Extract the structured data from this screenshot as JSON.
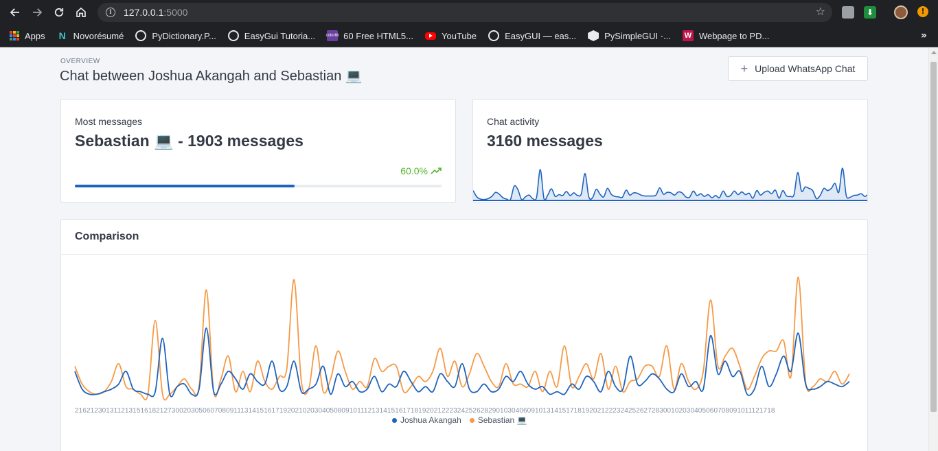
{
  "browser": {
    "url_host": "127.0.0.1",
    "url_port": ":5000",
    "bookmarks": [
      {
        "label": "Apps",
        "icon": "apps-icon"
      },
      {
        "label": "Novorésumé",
        "icon": "novoresume-icon"
      },
      {
        "label": "PyDictionary.P...",
        "icon": "globe-icon"
      },
      {
        "label": "EasyGui Tutoria...",
        "icon": "globe-icon"
      },
      {
        "label": "60 Free HTML5...",
        "icon": "colorlib-icon"
      },
      {
        "label": "YouTube",
        "icon": "youtube-icon"
      },
      {
        "label": "EasyGUI — eas...",
        "icon": "globe-icon"
      },
      {
        "label": "PySimpleGUI ·...",
        "icon": "pysimplegui-icon"
      },
      {
        "label": "Webpage to PD...",
        "icon": "webpage-to-pdf-icon"
      }
    ],
    "more": "»"
  },
  "header": {
    "overline": "OVERVIEW",
    "title": "Chat between Joshua Akangah and Sebastian 💻",
    "upload_label": "Upload WhatsApp Chat"
  },
  "most_messages": {
    "label": "Most messages",
    "value": "Sebastian 💻 - 1903 messages",
    "percent": "60.0%",
    "progress": 0.6
  },
  "chat_activity": {
    "label": "Chat activity",
    "value": "3160 messages"
  },
  "comparison": {
    "title": "Comparison",
    "colors": {
      "joshua": "#1e64be",
      "sebastian": "#f59a46"
    }
  },
  "chart_data": {
    "type": "line",
    "x_tick_text": "2162123013112131516182127300203050607080911131415161719202102030405080910111213141516171819202122232425262829010304060910131415171819202122232425262728300102030405060708091011121718",
    "series": [
      {
        "name": "Joshua Akangah",
        "values": [
          10,
          3,
          1,
          1,
          2,
          3,
          5,
          10,
          3,
          2,
          1,
          2,
          23,
          1,
          4,
          5,
          1,
          3,
          27,
          2,
          5,
          10,
          7,
          3,
          9,
          6,
          5,
          14,
          3,
          4,
          14,
          2,
          3,
          5,
          12,
          1,
          9,
          4,
          6,
          2,
          3,
          8,
          2,
          5,
          4,
          10,
          6,
          2,
          4,
          2,
          9,
          6,
          4,
          13,
          3,
          2,
          5,
          2,
          3,
          8,
          6,
          10,
          5,
          3,
          4,
          1,
          2,
          1,
          5,
          3,
          8,
          6,
          2,
          10,
          4,
          3,
          16,
          5,
          6,
          9,
          7,
          3,
          2,
          9,
          4,
          6,
          3,
          24,
          9,
          14,
          8,
          10,
          1,
          3,
          12,
          4,
          9,
          16,
          10,
          25,
          5,
          3,
          4,
          6,
          5,
          4,
          6
        ]
      },
      {
        "name": "Sebastian 💻",
        "values": [
          12,
          5,
          2,
          1,
          2,
          6,
          13,
          4,
          3,
          1,
          1,
          30,
          1,
          1,
          4,
          7,
          3,
          4,
          42,
          2,
          7,
          16,
          2,
          10,
          2,
          14,
          6,
          3,
          8,
          11,
          46,
          6,
          3,
          20,
          2,
          7,
          18,
          10,
          3,
          6,
          4,
          15,
          10,
          12,
          12,
          2,
          4,
          8,
          6,
          10,
          19,
          8,
          14,
          4,
          9,
          17,
          12,
          6,
          4,
          13,
          5,
          5,
          4,
          10,
          2,
          10,
          4,
          20,
          4,
          8,
          13,
          7,
          17,
          3,
          12,
          2,
          6,
          7,
          12,
          12,
          8,
          20,
          3,
          13,
          6,
          3,
          10,
          38,
          12,
          16,
          19,
          12,
          3,
          8,
          15,
          18,
          18,
          22,
          8,
          47,
          6,
          4,
          7,
          6,
          10,
          5,
          9
        ]
      }
    ]
  }
}
